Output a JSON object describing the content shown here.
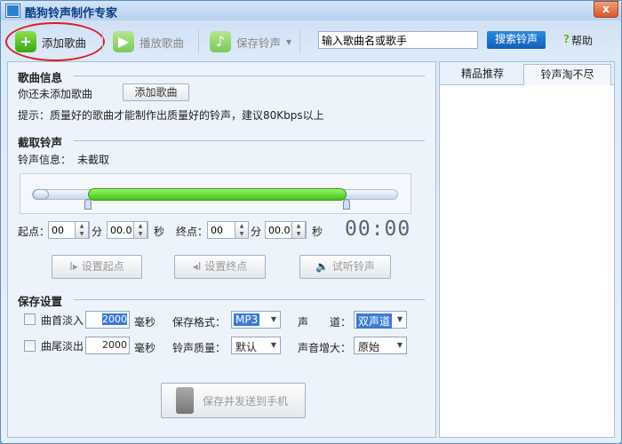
{
  "window": {
    "title": "酷狗铃声制作专家",
    "close_label": "x"
  },
  "toolbar": {
    "add_song": "添加歌曲",
    "play_song": "播放歌曲",
    "save_ringtone": "保存铃声",
    "search_placeholder": "输入歌曲名或歌手",
    "search_button": "搜索铃声",
    "help": "帮助"
  },
  "song_info": {
    "heading": "歌曲信息",
    "status": "你还未添加歌曲",
    "add_button": "添加歌曲",
    "tip": "提示：质量好的歌曲才能制作出质量好的铃声，建议80Kbps以上"
  },
  "clip": {
    "heading": "截取铃声",
    "info_label": "铃声信息：",
    "info_value": "未截取",
    "selection_start_fraction": 0.15,
    "selection_end_fraction": 0.86,
    "start_label": "起点：",
    "start_min": "00",
    "min_unit": "分",
    "start_sec": "00.0",
    "sec_unit": "秒",
    "end_label": "终点：",
    "end_min": "00",
    "end_sec": "00.0",
    "timer": "00:00",
    "set_start": "设置起点",
    "set_end": "设置终点",
    "preview": "试听铃声"
  },
  "save": {
    "heading": "保存设置",
    "fade_in_label": "曲首淡入",
    "fade_in_value": "2000",
    "fade_out_label": "曲尾淡出",
    "fade_out_value": "2000",
    "ms_unit": "毫秒",
    "format_label": "保存格式：",
    "format_value": "MP3",
    "channel_label": "声　　道：",
    "channel_value": "双声道",
    "quality_label": "铃声质量：",
    "quality_value": "默认",
    "boost_label": "声音增大：",
    "boost_value": "原始",
    "send_button": "保存并发送到手机"
  },
  "right_panel": {
    "tabs": [
      "精品推荐",
      "铃声淘不尽"
    ]
  },
  "colors": {
    "accent": "#1a6fc9",
    "green": "#5fd11f",
    "annotation": "#d92020"
  }
}
